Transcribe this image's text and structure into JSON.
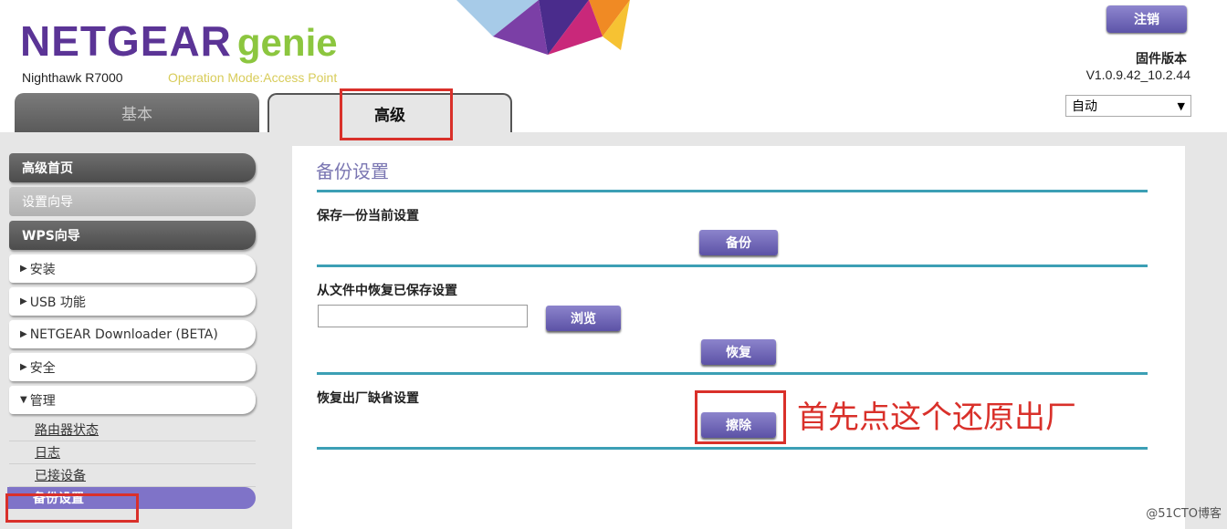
{
  "header": {
    "logo_main": "NETGEAR",
    "logo_genie": "genie",
    "model": "Nighthawk R7000",
    "operation_mode": "Operation Mode:Access Point",
    "logout_label": "注销",
    "firmware_label": "固件版本",
    "firmware_version": "V1.0.9.42_10.2.44",
    "language_value": "自动"
  },
  "tabs": [
    {
      "label": "基本"
    },
    {
      "label": "高级"
    }
  ],
  "sidebar": {
    "items": [
      {
        "label": "高级首页"
      },
      {
        "label": "设置向导"
      },
      {
        "label": "WPS向导"
      },
      {
        "label": "安装"
      },
      {
        "label": "USB 功能"
      },
      {
        "label": "NETGEAR Downloader (BETA)"
      },
      {
        "label": "安全"
      },
      {
        "label": "管理"
      }
    ],
    "subitems": [
      {
        "label": "路由器状态"
      },
      {
        "label": "日志"
      },
      {
        "label": "已接设备"
      },
      {
        "label": "备份设置"
      }
    ]
  },
  "main": {
    "title": "备份设置",
    "save_label": "保存一份当前设置",
    "backup_button": "备份",
    "restore_label": "从文件中恢复已保存设置",
    "file_input_value": "",
    "browse_button": "浏览",
    "restore_button": "恢复",
    "factory_label": "恢复出厂缺省设置",
    "erase_button": "擦除"
  },
  "annotation": {
    "text": "首先点这个还原出厂"
  },
  "watermark": "@51CTO博客",
  "colors": {
    "brand_purple": "#5b3496",
    "genie_green": "#8cc63f",
    "button_purple": "#6a60b6",
    "rule_teal": "#3c9fb5",
    "highlight_red": "#d9302a"
  }
}
